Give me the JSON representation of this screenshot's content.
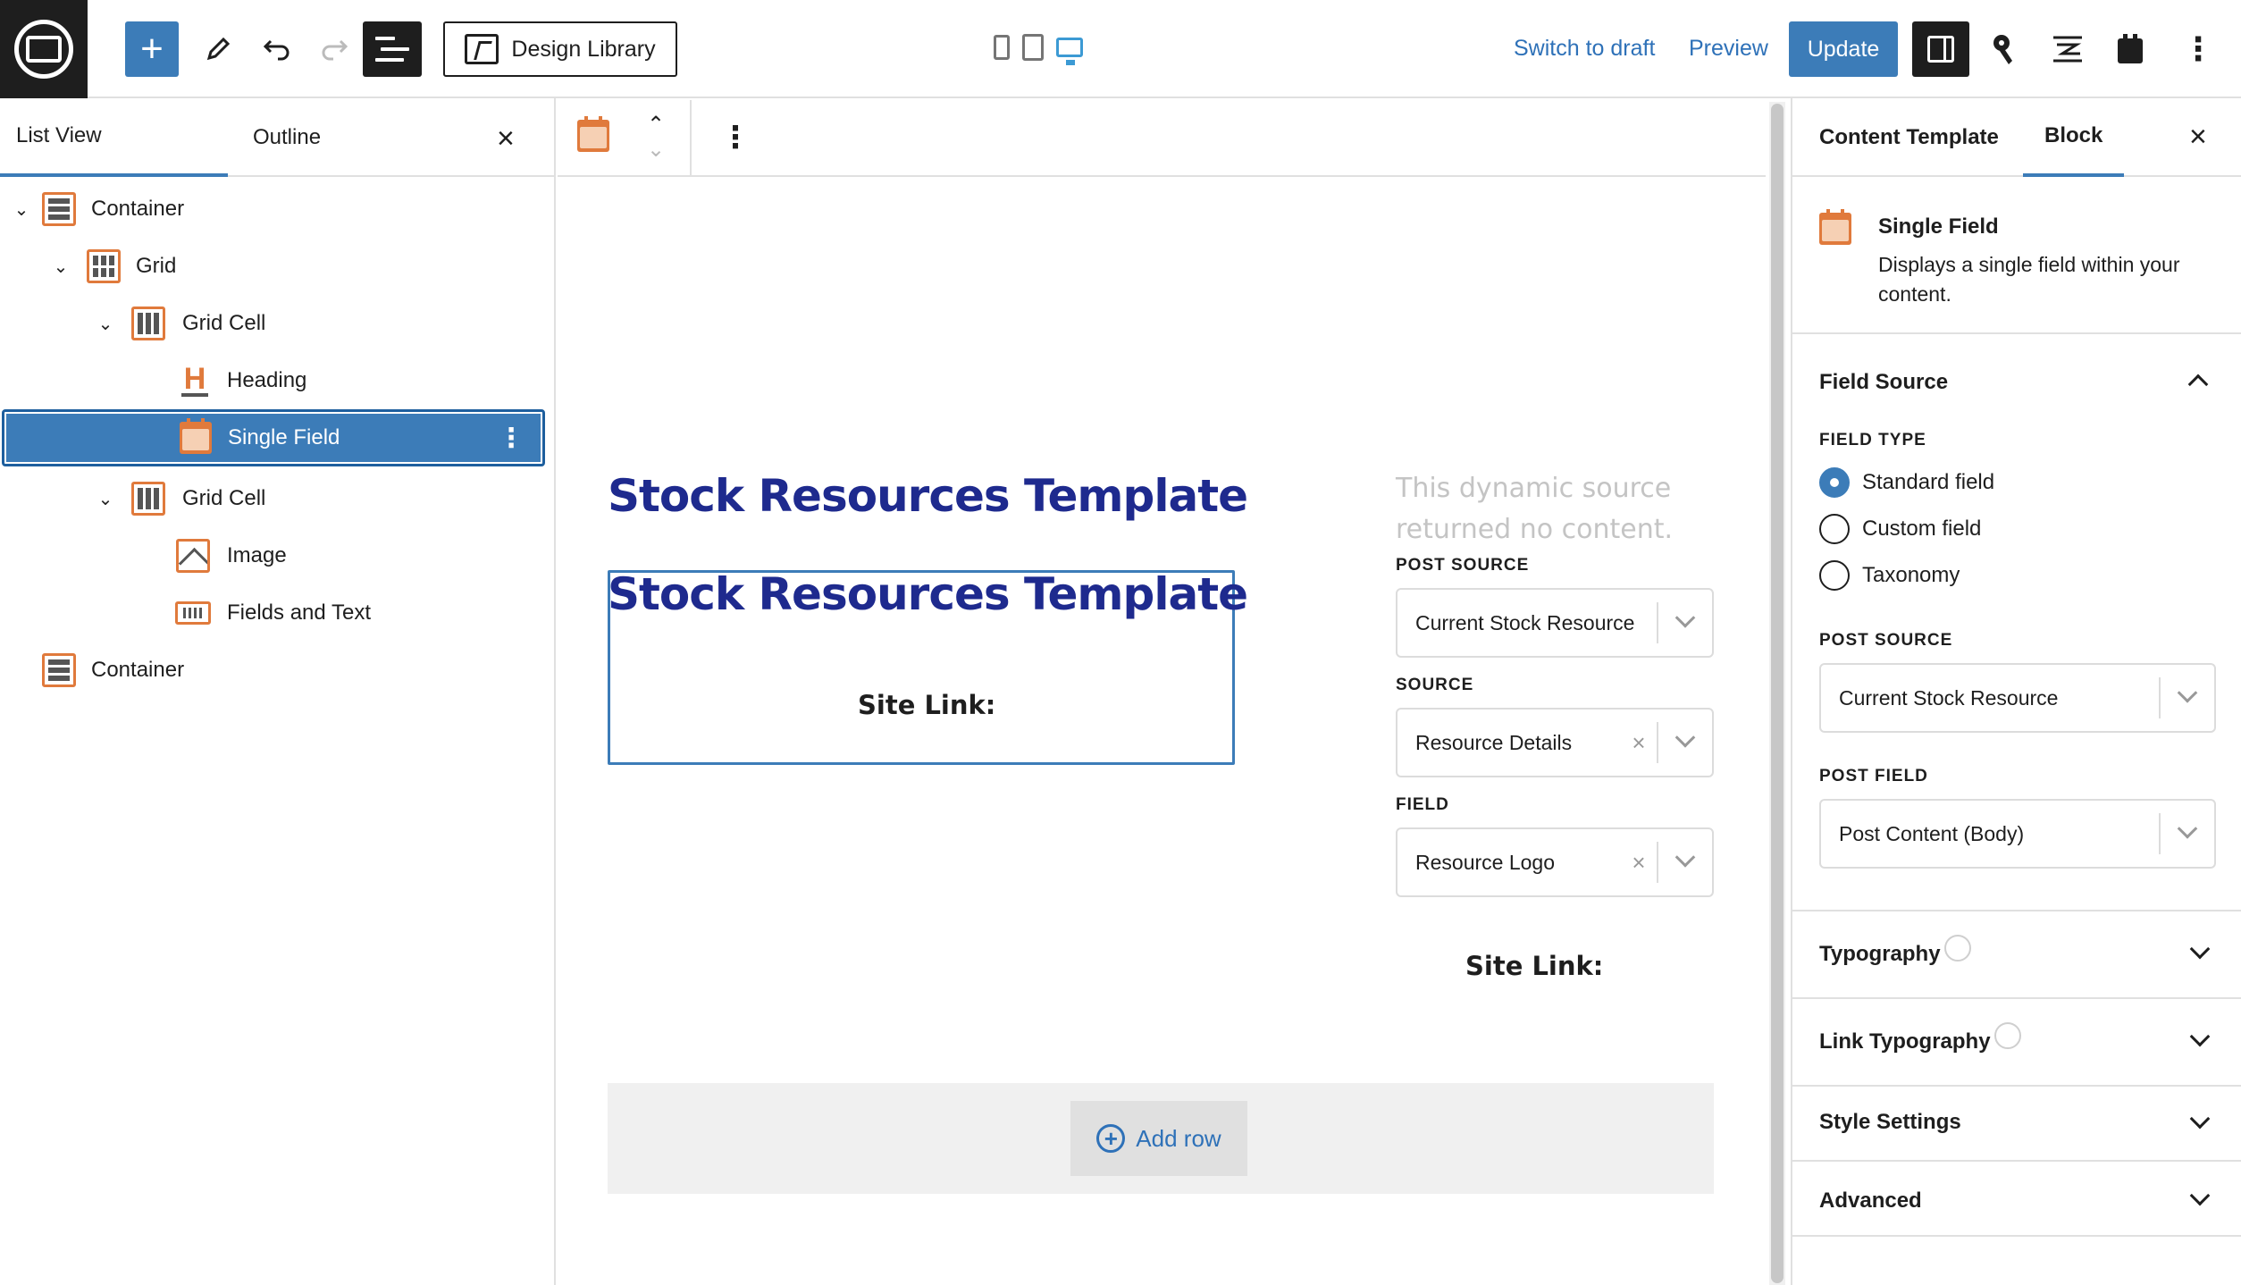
{
  "topbar": {
    "design_library_label": "Design Library",
    "switch_to_draft_label": "Switch to draft",
    "preview_label": "Preview",
    "update_label": "Update",
    "more_label": "⋮",
    "accent_color": "#3c7cb8"
  },
  "left_panel": {
    "tabs": [
      {
        "label": "List View",
        "active": true
      },
      {
        "label": "Outline",
        "active": false
      }
    ],
    "close_label": "×",
    "tree": [
      {
        "label": "Container",
        "icon": "container-icon",
        "depth": 0,
        "expanded": true
      },
      {
        "label": "Grid",
        "icon": "grid-icon",
        "depth": 1,
        "expanded": true
      },
      {
        "label": "Grid Cell",
        "icon": "grid-cell-icon",
        "depth": 2,
        "expanded": true
      },
      {
        "label": "Heading",
        "icon": "heading-icon",
        "depth": 3
      },
      {
        "label": "Single Field",
        "icon": "single-field-icon",
        "depth": 3,
        "selected": true
      },
      {
        "label": "Grid Cell",
        "icon": "grid-cell-icon",
        "depth": 2,
        "expanded": true
      },
      {
        "label": "Image",
        "icon": "image-icon",
        "depth": 3
      },
      {
        "label": "Fields and Text",
        "icon": "fields-and-text-icon",
        "depth": 3
      },
      {
        "label": "Container",
        "icon": "container-icon",
        "depth": 0
      }
    ],
    "row_more_label": "⋮"
  },
  "block_toolbar": {
    "more_label": "⋮",
    "up_label": "⌃",
    "down_label": "⌄"
  },
  "canvas": {
    "heading_top": "Stock Resources Template",
    "heading_selected": "Stock Resources Template",
    "site_link_left": "Site Link:",
    "site_link_right": "Site Link:",
    "dynamic_message": "This dynamic source returned no content.",
    "post_source_label": "POST SOURCE",
    "post_source_value": "Current Stock Resource",
    "source_label": "SOURCE",
    "source_value": "Resource Details",
    "field_label": "FIELD",
    "field_value": "Resource Logo",
    "clear_label": "×",
    "add_row_label": "Add row",
    "heading_color": "#1e2a8e"
  },
  "right_panel": {
    "tabs": [
      {
        "label": "Content Template",
        "active": false
      },
      {
        "label": "Block",
        "active": true
      }
    ],
    "close_label": "×",
    "block_title": "Single Field",
    "block_description": "Displays a single field within your content.",
    "field_source_title": "Field Source",
    "field_type_label": "FIELD TYPE",
    "field_types": [
      {
        "label": "Standard field",
        "checked": true
      },
      {
        "label": "Custom field",
        "checked": false
      },
      {
        "label": "Taxonomy",
        "checked": false
      }
    ],
    "post_source_label": "POST SOURCE",
    "post_source_value": "Current Stock Resource",
    "post_field_label": "POST FIELD",
    "post_field_value": "Post Content (Body)",
    "panels": [
      {
        "label": "Typography",
        "has_dot": true
      },
      {
        "label": "Link Typography",
        "has_dot": true
      },
      {
        "label": "Style Settings",
        "has_dot": false
      },
      {
        "label": "Advanced",
        "has_dot": false
      }
    ]
  }
}
